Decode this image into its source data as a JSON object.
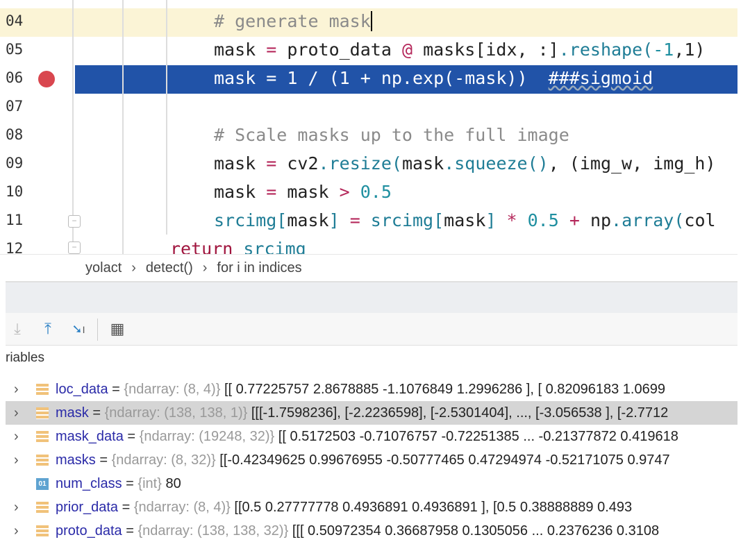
{
  "editor": {
    "lines": [
      {
        "num": "04",
        "state": "caret",
        "tokens": [
          {
            "t": "# generate mask",
            "k": "comment"
          }
        ]
      },
      {
        "num": "05",
        "tokens": [
          {
            "t": "mask ",
            "k": "plain"
          },
          {
            "t": "=",
            "k": "op"
          },
          {
            "t": " proto_data ",
            "k": "plain"
          },
          {
            "t": "@",
            "k": "op"
          },
          {
            "t": " masks[idx, :]",
            "k": "plain"
          },
          {
            "t": ".reshape(",
            "k": "fn"
          },
          {
            "t": "-1",
            "k": "num"
          },
          {
            "t": ",1)",
            "k": "plain"
          }
        ]
      },
      {
        "num": "06",
        "state": "exec",
        "breakpoint": true,
        "tokens": [
          {
            "t": "mask = 1 / (1 + np.exp(-mask))  ",
            "k": "plain"
          },
          {
            "t": "###sigmoid",
            "k": "plain",
            "squig": true
          }
        ]
      },
      {
        "num": "07",
        "tokens": []
      },
      {
        "num": "08",
        "tokens": [
          {
            "t": "# Scale masks up to the full image",
            "k": "comment"
          }
        ]
      },
      {
        "num": "09",
        "tokens": [
          {
            "t": "mask ",
            "k": "plain"
          },
          {
            "t": "=",
            "k": "op"
          },
          {
            "t": " cv2",
            "k": "plain"
          },
          {
            "t": ".resize(",
            "k": "fn"
          },
          {
            "t": "mask",
            "k": "plain"
          },
          {
            "t": ".squeeze()",
            "k": "fn"
          },
          {
            "t": ", (img_w, img_h)",
            "k": "plain"
          }
        ]
      },
      {
        "num": "10",
        "tokens": [
          {
            "t": "mask ",
            "k": "plain"
          },
          {
            "t": "=",
            "k": "op"
          },
          {
            "t": " mask ",
            "k": "plain"
          },
          {
            "t": ">",
            "k": "op"
          },
          {
            "t": " 0.5",
            "k": "num"
          }
        ]
      },
      {
        "num": "11",
        "tokens": [
          {
            "t": "srcimg[",
            "k": "fn"
          },
          {
            "t": "mask",
            "k": "plain"
          },
          {
            "t": "] ",
            "k": "fn"
          },
          {
            "t": "=",
            "k": "op"
          },
          {
            "t": " srcimg[",
            "k": "fn"
          },
          {
            "t": "mask",
            "k": "plain"
          },
          {
            "t": "] ",
            "k": "fn"
          },
          {
            "t": "*",
            "k": "op"
          },
          {
            "t": " 0.5 ",
            "k": "num"
          },
          {
            "t": "+",
            "k": "op"
          },
          {
            "t": " np",
            "k": "plain"
          },
          {
            "t": ".array(",
            "k": "fn"
          },
          {
            "t": "col",
            "k": "plain"
          }
        ]
      },
      {
        "num": "12",
        "indent": "back",
        "tokens": [
          {
            "t": "return",
            "k": "kw"
          },
          {
            "t": " srcimg",
            "k": "fn"
          }
        ]
      }
    ],
    "colors": {
      "exec_line": "#2153a8",
      "caret_line": "#fbf4d6",
      "breakpoint": "#d9474f"
    }
  },
  "breadcrumb": [
    "yolact",
    "detect()",
    "for i in indices"
  ],
  "toolbar": {
    "icons": [
      "download-icon",
      "upload-icon",
      "step-into-cursor-icon",
      "table-icon"
    ]
  },
  "variables": {
    "header": "riables",
    "rows": [
      {
        "name": "loc_data",
        "type": "{ndarray: (8, 4)}",
        "value": "[[ 0.77225757  2.8678885  -1.1076849   1.2996286 ], [ 0.82096183  1.0699",
        "icon": "array",
        "expandable": true
      },
      {
        "name": "mask",
        "type": "{ndarray: (138, 138, 1)}",
        "value": "[[[-1.7598236],  [-2.2236598],  [-2.5301404],  ...,  [-3.056538 ],  [-2.7712",
        "icon": "array",
        "expandable": true,
        "selected": true
      },
      {
        "name": "mask_data",
        "type": "{ndarray: (19248, 32)}",
        "value": "[[ 0.5172503  -0.71076757 -0.72251385 ... -0.21377872  0.419618",
        "icon": "array",
        "expandable": true
      },
      {
        "name": "masks",
        "type": "{ndarray: (8, 32)}",
        "value": "[[-0.42349625  0.99676955 -0.50777465  0.47294974 -0.52171075  0.9747",
        "icon": "array",
        "expandable": true
      },
      {
        "name": "num_class",
        "type": "{int}",
        "value": "80",
        "icon": "int",
        "icon_label": "01",
        "expandable": false
      },
      {
        "name": "prior_data",
        "type": "{ndarray: (8, 4)}",
        "value": "[[0.5        0.27777778 0.4936891  0.4936891 ], [0.5        0.38888889 0.493",
        "icon": "array",
        "expandable": true
      },
      {
        "name": "proto_data",
        "type": "{ndarray: (138, 138, 32)}",
        "value": "[[[ 0.50972354  0.36687958  0.1305056  ...  0.2376236   0.3108",
        "icon": "array",
        "expandable": true
      }
    ]
  }
}
